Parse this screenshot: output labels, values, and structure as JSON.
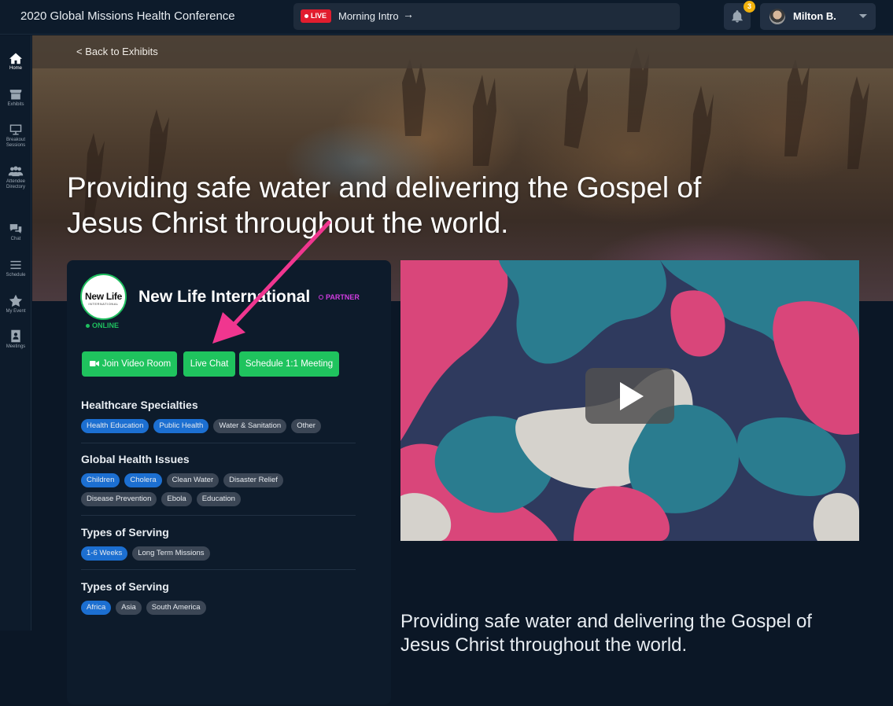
{
  "app": {
    "title": "2020 Global Missions Health Conference"
  },
  "live": {
    "badge": "LIVE",
    "session": "Morning Intro",
    "arrow": "→"
  },
  "notifications": {
    "count": "3"
  },
  "user": {
    "name": "Milton B."
  },
  "sidebar": {
    "items": [
      {
        "label": "Home",
        "icon": "home-icon"
      },
      {
        "label": "Exhibits",
        "icon": "storefront-icon"
      },
      {
        "label": "Breakout Sessions",
        "icon": "presentation-icon"
      },
      {
        "label": "Attendee Directory",
        "icon": "people-icon"
      },
      {
        "label": "Chat",
        "icon": "chat-icon"
      },
      {
        "label": "Schedule",
        "icon": "list-icon"
      },
      {
        "label": "My Event",
        "icon": "star-icon"
      },
      {
        "label": "Meetings",
        "icon": "contact-book-icon"
      }
    ]
  },
  "hero": {
    "back_label": "< Back to Exhibits",
    "title": "Providing safe water and delivering the Gospel of Jesus Christ throughout the world."
  },
  "exhibitor": {
    "logo_text": "New Life",
    "logo_subtext": "INTERNATIONAL",
    "status": "ONLINE",
    "name": "New Life International",
    "badge": "PARTNER",
    "actions": {
      "video": "Join Video Room",
      "chat": "Live Chat",
      "meeting": "Schedule 1:1 Meeting"
    },
    "sections": [
      {
        "title": "Healthcare Specialties",
        "tags": [
          {
            "label": "Health Education",
            "selected": true
          },
          {
            "label": "Public Health",
            "selected": true
          },
          {
            "label": "Water & Sanitation",
            "selected": false
          },
          {
            "label": "Other",
            "selected": false
          }
        ]
      },
      {
        "title": "Global Health Issues",
        "tags": [
          {
            "label": "Children",
            "selected": true
          },
          {
            "label": "Cholera",
            "selected": true
          },
          {
            "label": "Clean Water",
            "selected": false
          },
          {
            "label": "Disaster Relief",
            "selected": false
          },
          {
            "label": "Disease Prevention",
            "selected": false
          },
          {
            "label": "Ebola",
            "selected": false
          },
          {
            "label": "Education",
            "selected": false
          }
        ]
      },
      {
        "title": "Types of Serving",
        "tags": [
          {
            "label": "1-6 Weeks",
            "selected": true
          },
          {
            "label": "Long Term Missions",
            "selected": false
          }
        ]
      },
      {
        "title": "Types of Serving",
        "tags": [
          {
            "label": "Africa",
            "selected": true
          },
          {
            "label": "Asia",
            "selected": false
          },
          {
            "label": "South America",
            "selected": false
          }
        ]
      }
    ]
  },
  "description": "Providing safe water and delivering the Gospel of Jesus Christ throughout the world.",
  "colors": {
    "accent_green": "#1fc35e",
    "live_red": "#e11d2e",
    "partner_magenta": "#d03ce0",
    "tag_selected": "#1c6fd1",
    "annotation_arrow": "#f0368f"
  }
}
